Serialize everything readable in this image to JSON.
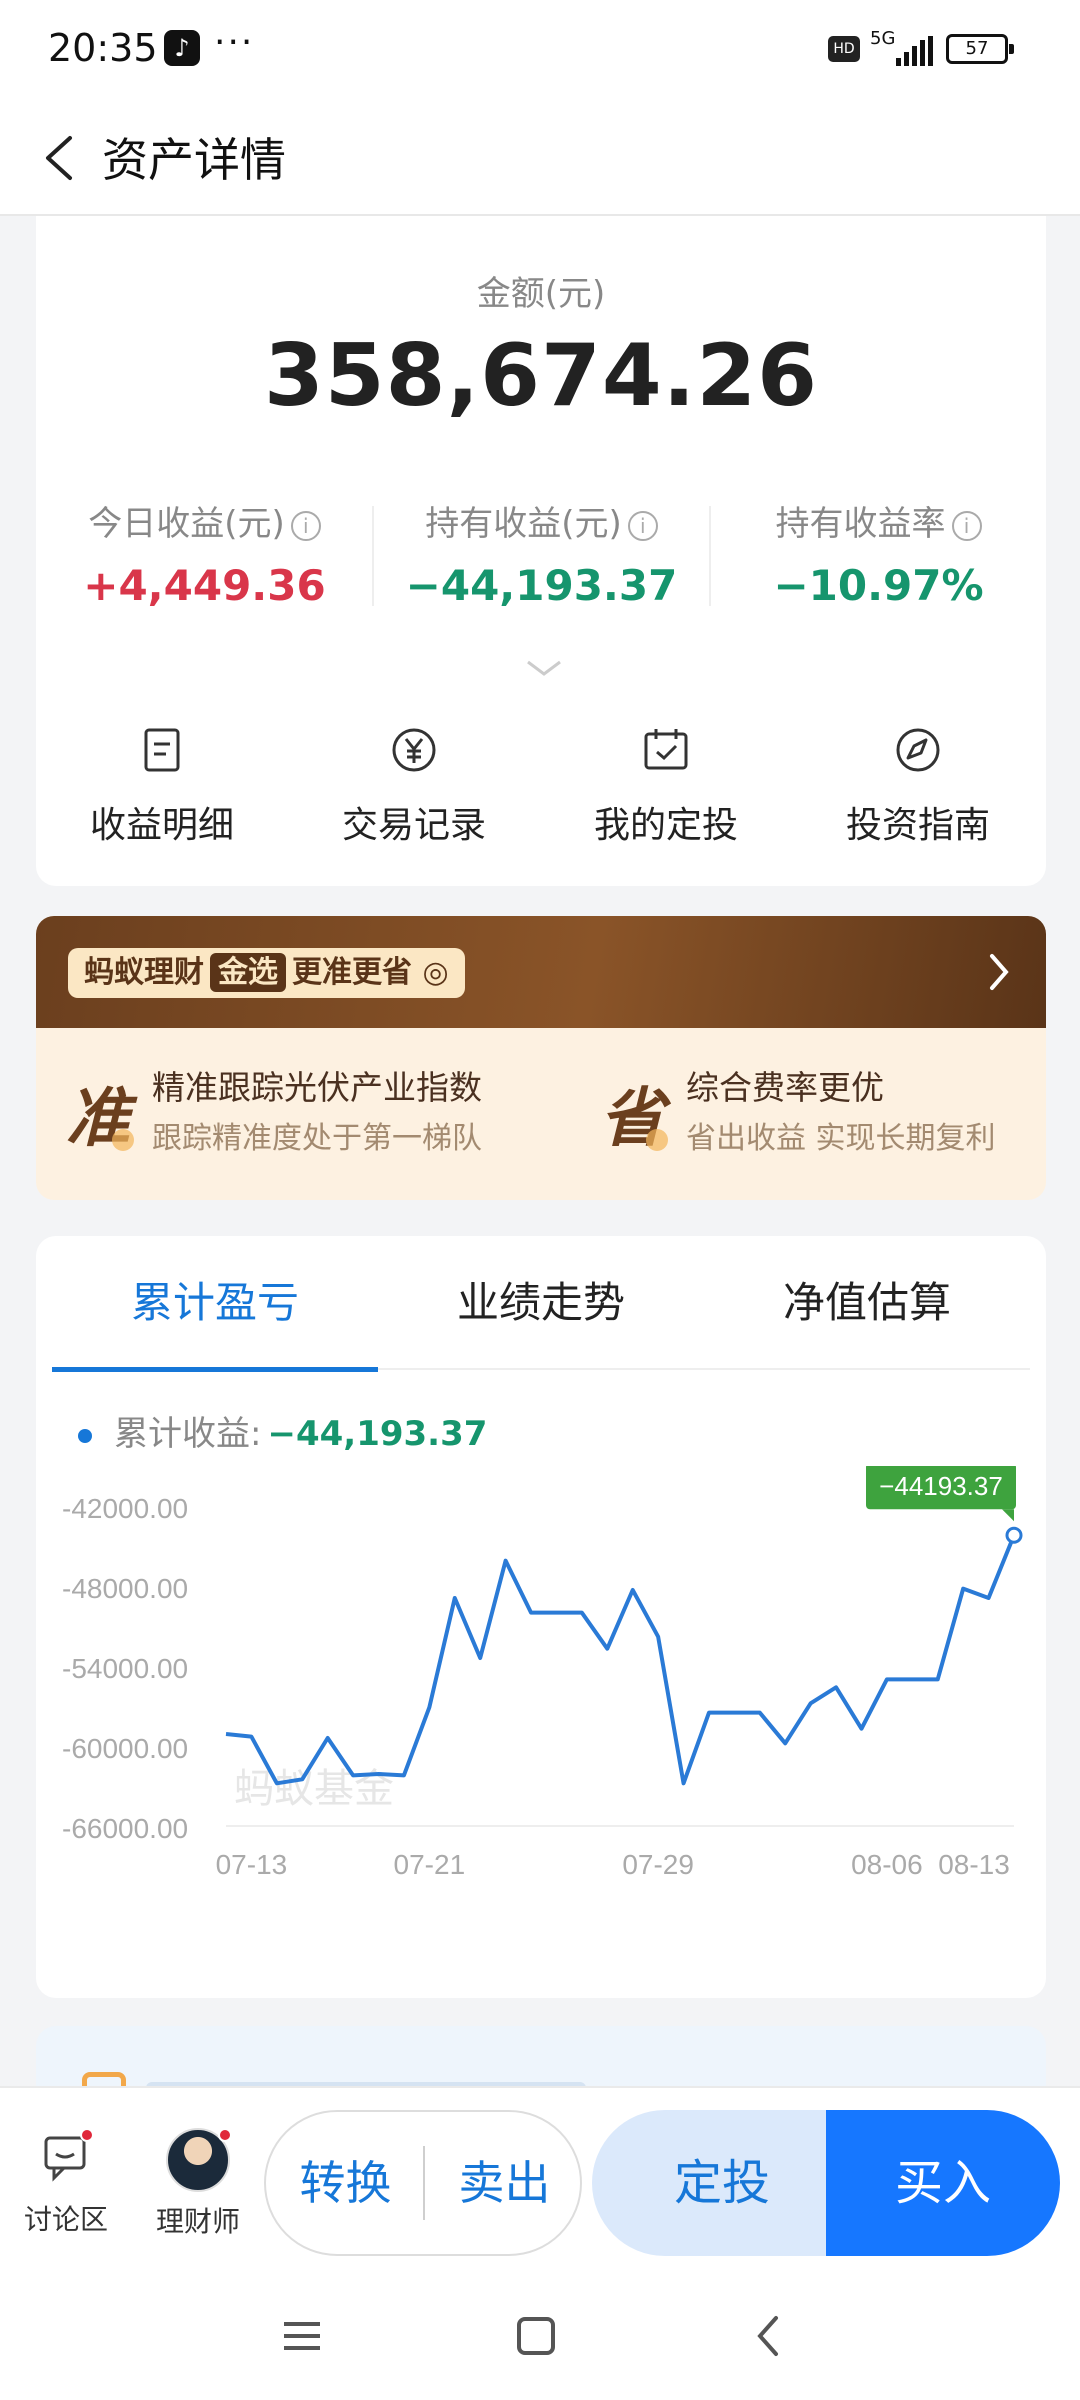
{
  "status_bar": {
    "time": "20:35",
    "network": "5G",
    "battery": "57"
  },
  "header": {
    "title": "资产详情"
  },
  "summary": {
    "amount_label": "金额(元)",
    "amount": "358,674.26",
    "stats": [
      {
        "label": "今日收益(元)",
        "value": "+4,449.36",
        "color": "#d9364a"
      },
      {
        "label": "持有收益(元)",
        "value": "−44,193.37",
        "color": "#16956d"
      },
      {
        "label": "持有收益率",
        "value": "−10.97%",
        "color": "#16956d"
      }
    ],
    "actions": [
      {
        "label": "收益明细",
        "icon": "document-icon"
      },
      {
        "label": "交易记录",
        "icon": "yen-icon"
      },
      {
        "label": "我的定投",
        "icon": "calendar-check-icon"
      },
      {
        "label": "投资指南",
        "icon": "compass-icon"
      }
    ]
  },
  "banner": {
    "brand": "蚂蚁理财",
    "badge": "金选",
    "slogan": "更准更省",
    "features": [
      {
        "glyph": "准",
        "title": "精准跟踪光伏产业指数",
        "subtitle": "跟踪精准度处于第一梯队"
      },
      {
        "glyph": "省",
        "title": "综合费率更优",
        "subtitle": "省出收益 实现长期复利"
      }
    ]
  },
  "chart_tabs": [
    "累计盈亏",
    "业绩走势",
    "净值估算"
  ],
  "chart_legend": {
    "label": "累计收益:",
    "value": "−44,193.37"
  },
  "chart_data": {
    "type": "line",
    "watermark": "蚂蚁基金",
    "ylim": [
      -66000,
      -42000
    ],
    "y_ticks": [
      "-42000.00",
      "-48000.00",
      "-54000.00",
      "-60000.00",
      "-66000.00"
    ],
    "x_tick_labels": [
      "07-13",
      "07-21",
      "07-29",
      "08-06",
      "08-13"
    ],
    "series": [
      {
        "values": [
          -59100,
          -59300,
          -62800,
          -62500,
          -59400,
          -62200,
          -62100,
          -62200,
          -57100,
          -48900,
          -53400,
          -46100,
          -50000,
          -50000,
          -50000,
          -52700,
          -48300,
          -51800,
          -62800,
          -57500,
          -57500,
          -57500,
          -59800,
          -56800,
          -55600,
          -58700,
          -55000,
          -55000,
          -55000,
          -48200,
          -48900,
          -44193.37
        ]
      }
    ],
    "last_value_label": "−44193.37",
    "line_color": "#2a7ad6"
  },
  "bottom_bar": {
    "discuss": "讨论区",
    "advisor": "理财师",
    "convert": "转换",
    "sell": "卖出",
    "auto_invest": "定投",
    "buy": "买入"
  }
}
